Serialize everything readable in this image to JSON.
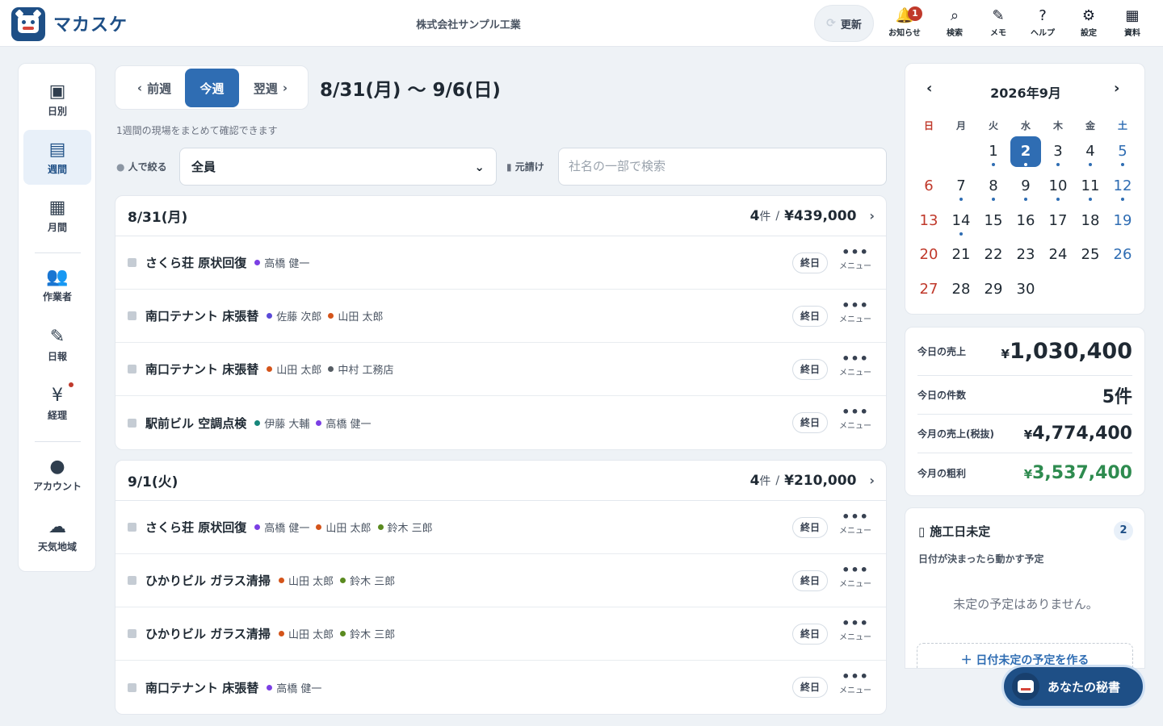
{
  "header": {
    "brand": "マカスケ",
    "company": "株式会社サンプル工業",
    "refresh_label": "更新",
    "icons": [
      {
        "name": "notification",
        "label": "お知らせ",
        "glyph": "🔔",
        "badge": "1"
      },
      {
        "name": "search",
        "label": "検索",
        "glyph": "⌕"
      },
      {
        "name": "memo",
        "label": "メモ",
        "glyph": "✎"
      },
      {
        "name": "help",
        "label": "ヘルプ",
        "glyph": "?"
      },
      {
        "name": "settings",
        "label": "設定",
        "glyph": "⚙"
      },
      {
        "name": "documents",
        "label": "資料",
        "glyph": "▦"
      }
    ]
  },
  "sidebar": {
    "items": [
      {
        "label": "日別",
        "icon": "calendar-day-icon",
        "glyph": "▣"
      },
      {
        "label": "週間",
        "icon": "calendar-week-icon",
        "glyph": "▤",
        "active": true
      },
      {
        "label": "月間",
        "icon": "calendar-month-icon",
        "glyph": "▦"
      },
      {
        "label": "作業者",
        "icon": "users-icon",
        "glyph": "👥"
      },
      {
        "label": "日報",
        "icon": "report-icon",
        "glyph": "✎"
      },
      {
        "label": "経理",
        "icon": "yen-icon",
        "glyph": "¥",
        "dot": true
      },
      {
        "label": "アカウント",
        "icon": "account-icon",
        "glyph": "●"
      },
      {
        "label": "天気地域",
        "icon": "cloud-icon",
        "glyph": "☁"
      }
    ]
  },
  "week_nav": {
    "prev": "前週",
    "current": "今週",
    "next": "翌週",
    "range": "8/31(月) 〜 9/6(日)",
    "subtitle": "1週間の現場をまとめて確認できます"
  },
  "filters": {
    "person_label": "人で絞る",
    "person_value": "全員",
    "contractor_label": "元請け",
    "contractor_placeholder": "社名の一部で検索"
  },
  "colors": {
    "accent": "#2f6db3",
    "brand": "#1e4f86",
    "purple": "#7b3fe4",
    "orange": "#d4541a",
    "teal": "#17877b",
    "green": "#5a8a1f",
    "gray": "#555c63"
  },
  "days": [
    {
      "date": "8/31(月)",
      "count": "4",
      "count_unit": "件",
      "sep": "/",
      "total": "¥439,000",
      "rows": [
        {
          "site": "さくら荘 原状回復",
          "workers": [
            {
              "name": "高橋 健一",
              "color": "#7b3fe4"
            }
          ],
          "tag": "終日",
          "menu": "メニュー"
        },
        {
          "site": "南口テナント 床張替",
          "workers": [
            {
              "name": "佐藤 次郎",
              "color": "#5b4ad8"
            },
            {
              "name": "山田 太郎",
              "color": "#d4541a"
            }
          ],
          "tag": "終日",
          "menu": "メニュー"
        },
        {
          "site": "南口テナント 床張替",
          "workers": [
            {
              "name": "山田 太郎",
              "color": "#d4541a"
            },
            {
              "name": "中村 工務店",
              "color": "#555c63"
            }
          ],
          "tag": "終日",
          "menu": "メニュー"
        },
        {
          "site": "駅前ビル 空調点検",
          "workers": [
            {
              "name": "伊藤 大輔",
              "color": "#17877b"
            },
            {
              "name": "高橋 健一",
              "color": "#7b3fe4"
            }
          ],
          "tag": "終日",
          "menu": "メニュー"
        }
      ]
    },
    {
      "date": "9/1(火)",
      "count": "4",
      "count_unit": "件",
      "sep": "/",
      "total": "¥210,000",
      "rows": [
        {
          "site": "さくら荘 原状回復",
          "workers": [
            {
              "name": "高橋 健一",
              "color": "#7b3fe4"
            },
            {
              "name": "山田 太郎",
              "color": "#d4541a"
            },
            {
              "name": "鈴木 三郎",
              "color": "#5a8a1f"
            }
          ],
          "tag": "終日",
          "menu": "メニュー"
        },
        {
          "site": "ひかりビル ガラス清掃",
          "workers": [
            {
              "name": "山田 太郎",
              "color": "#d4541a"
            },
            {
              "name": "鈴木 三郎",
              "color": "#5a8a1f"
            }
          ],
          "tag": "終日",
          "menu": "メニュー"
        },
        {
          "site": "ひかりビル ガラス清掃",
          "workers": [
            {
              "name": "山田 太郎",
              "color": "#d4541a"
            },
            {
              "name": "鈴木 三郎",
              "color": "#5a8a1f"
            }
          ],
          "tag": "終日",
          "menu": "メニュー"
        },
        {
          "site": "南口テナント 床張替",
          "workers": [
            {
              "name": "高橋 健一",
              "color": "#7b3fe4"
            }
          ],
          "tag": "終日",
          "menu": "メニュー"
        }
      ]
    }
  ],
  "calendar": {
    "title": "2026年9月",
    "weekdays": [
      "日",
      "月",
      "火",
      "水",
      "木",
      "金",
      "土"
    ],
    "first_weekday": 2,
    "days_in_month": 30,
    "today": 2,
    "event_days": [
      1,
      2,
      3,
      4,
      5,
      7,
      8,
      9,
      10,
      11,
      12,
      14
    ]
  },
  "stats": [
    {
      "label": "今日の売上",
      "yen": "¥",
      "value": "1,030,400",
      "style": "big"
    },
    {
      "label": "今日の件数",
      "yen": "",
      "value": "5件",
      "style": ""
    },
    {
      "label": "今月の売上(税抜)",
      "yen": "¥",
      "value": "4,774,400",
      "style": ""
    },
    {
      "label": "今月の粗利",
      "yen": "¥",
      "value": "3,537,400",
      "style": "green"
    }
  ],
  "unscheduled": {
    "title": "施工日未定",
    "count": "2",
    "subtitle": "日付が決まったら動かす予定",
    "empty": "未定の予定はありません。",
    "create": "＋ 日付未定の予定を作る"
  },
  "assistant": {
    "label": "あなたの秘書"
  }
}
